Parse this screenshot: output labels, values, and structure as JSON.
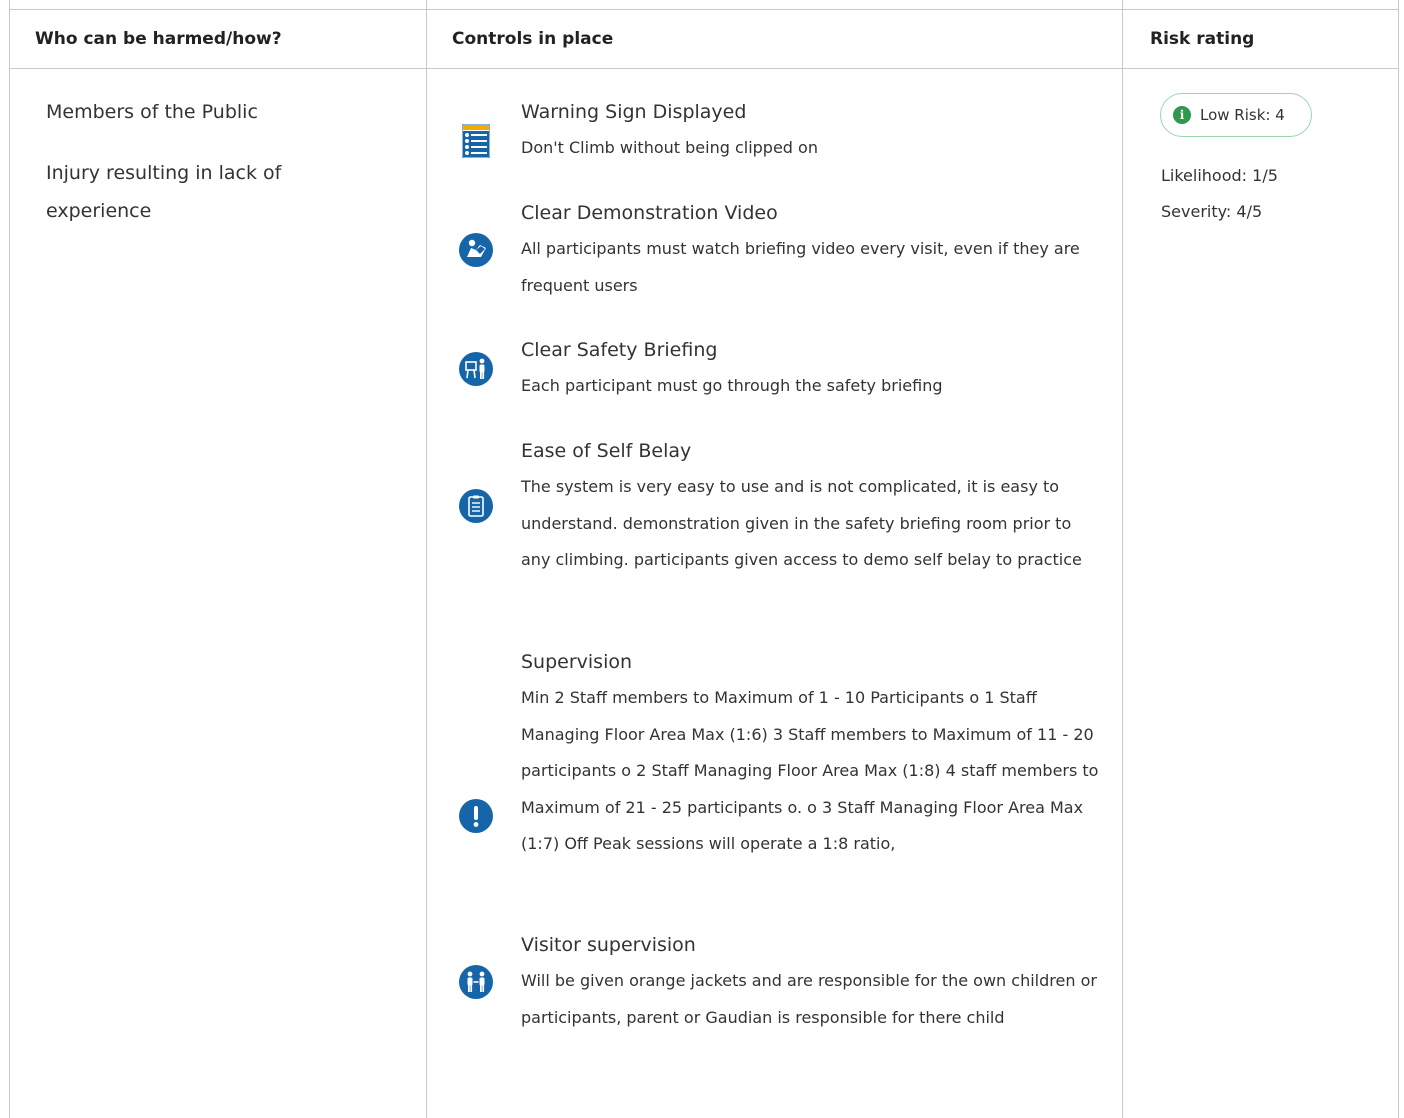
{
  "headers": {
    "who": "Who can be harmed/how?",
    "controls": "Controls in place",
    "risk": "Risk rating"
  },
  "who": {
    "group": "Members of the Public",
    "harm": "Injury resulting in lack of experience"
  },
  "controls": [
    {
      "icon": "warning-sign-poster-icon",
      "title": "Warning Sign Displayed",
      "desc": "Don't Climb without being clipped on"
    },
    {
      "icon": "read-manual-icon",
      "title": "Clear Demonstration Video",
      "desc": "All participants must watch briefing video every visit, even if they are frequent users"
    },
    {
      "icon": "presentation-briefing-icon",
      "title": "Clear Safety Briefing",
      "desc": "Each participant must go through the safety briefing"
    },
    {
      "icon": "clipboard-checklist-icon",
      "title": "Ease of Self Belay",
      "desc": "The system is very easy to use and is not complicated, it is easy to understand. demonstration given in the safety briefing room prior to any climbing. participants given access to demo self belay to practice"
    },
    {
      "icon": "exclamation-icon",
      "title": "Supervision",
      "desc": "Min 2 Staff members to Maximum of 1 - 10 Participants o 1 Staff Managing Floor Area Max (1:6) 3 Staff members to Maximum of 11 - 20 participants o 2 Staff Managing Floor Area Max (1:8) 4 staff members to Maximum of 21 - 25 participants o. o 3 Staff Managing Floor Area Max (1:7) Off Peak sessions will operate a 1:8 ratio,"
    },
    {
      "icon": "two-people-icon",
      "title": "Visitor supervision",
      "desc": "Will be given orange jackets and are responsible for the own children or participants, parent or Gaudian is responsible for there child"
    }
  ],
  "risk": {
    "badge": "Low Risk: 4",
    "badge_icon": "info-icon",
    "likelihood": "Likelihood: 1/5",
    "severity": "Severity: 4/5",
    "colors": {
      "low": "#2e9a4e",
      "icon_blue": "#1565a8"
    }
  }
}
